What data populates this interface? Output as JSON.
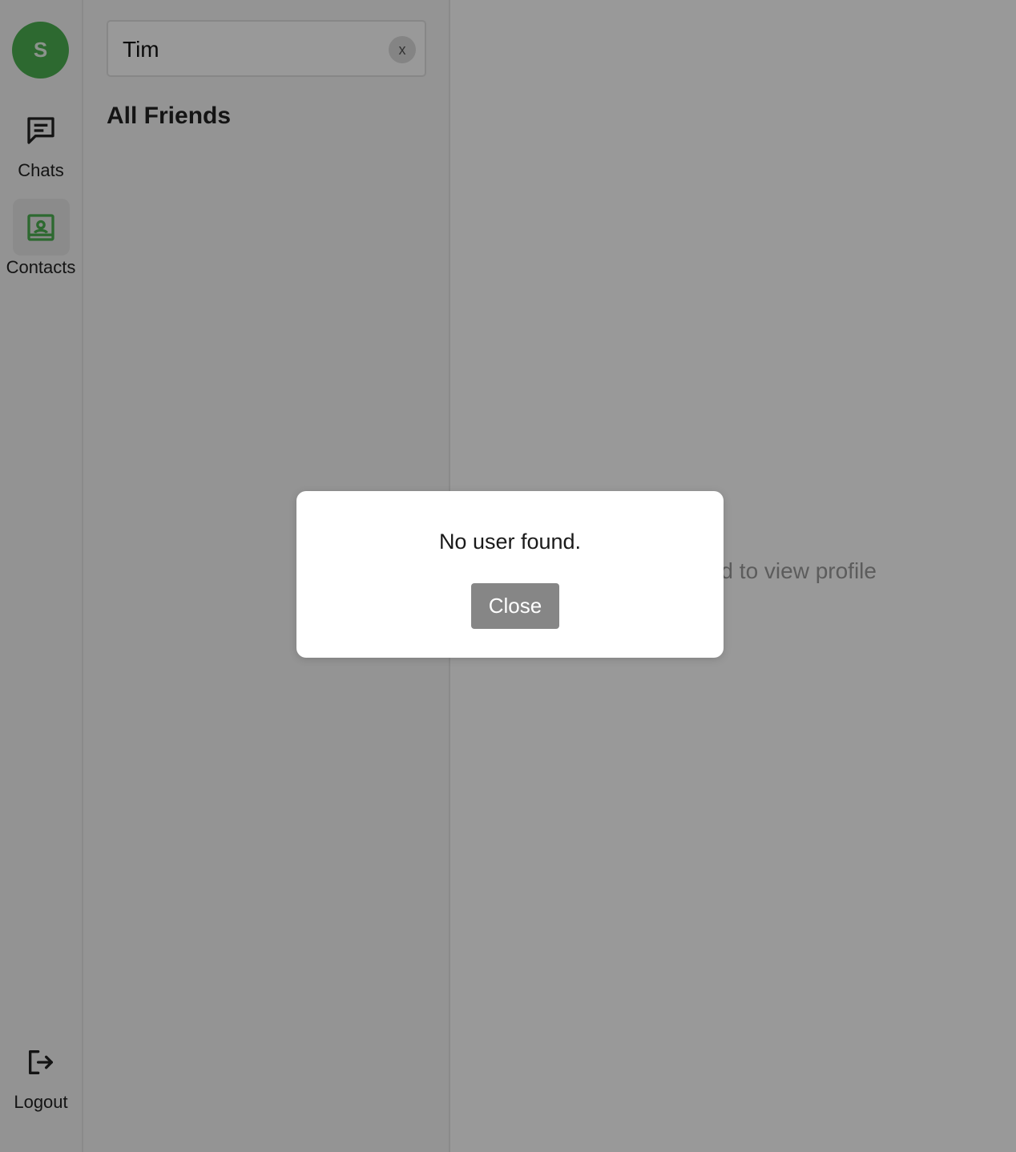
{
  "colors": {
    "avatar_bg": "#4caf50",
    "active_nav_icon": "#4caf50",
    "overlay": "rgba(0,0,0,0.4)",
    "close_button_bg": "#868686"
  },
  "sidebar": {
    "avatar_initial": "S",
    "items": [
      {
        "label": "Chats",
        "icon": "chat-message-icon",
        "active": false
      },
      {
        "label": "Contacts",
        "icon": "contact-card-icon",
        "active": true
      }
    ],
    "logout": {
      "label": "Logout",
      "icon": "logout-icon"
    }
  },
  "contacts_panel": {
    "search": {
      "value": "Tim",
      "clear_label": "x"
    },
    "section_title": "All Friends"
  },
  "detail_panel": {
    "placeholder": "Select a friend to view profile"
  },
  "modal": {
    "message": "No user found.",
    "close_label": "Close"
  }
}
